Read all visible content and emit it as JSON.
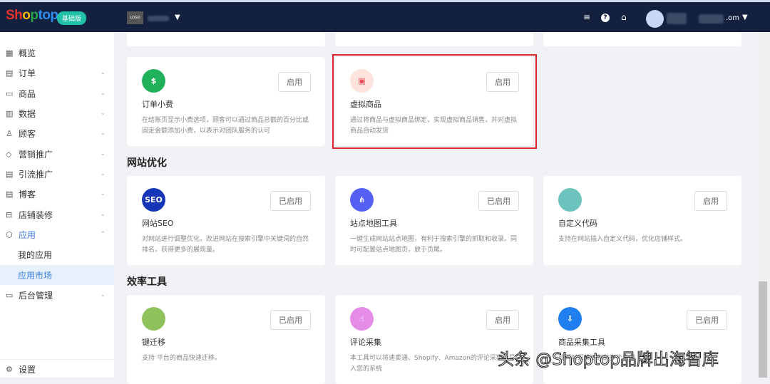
{
  "header": {
    "logo": "Shoptop",
    "plan": "基础版",
    "store_logo": "LOGO",
    "account_suffix": ".om"
  },
  "sidebar": {
    "items": [
      {
        "label": "概览",
        "icon": "dashboard-icon"
      },
      {
        "label": "订单",
        "icon": "order-icon"
      },
      {
        "label": "商品",
        "icon": "product-icon"
      },
      {
        "label": "数据",
        "icon": "chart-icon"
      },
      {
        "label": "顾客",
        "icon": "user-icon"
      },
      {
        "label": "营销推广",
        "icon": "tag-icon"
      },
      {
        "label": "引流推广",
        "icon": "traffic-icon"
      },
      {
        "label": "博客",
        "icon": "blog-icon"
      },
      {
        "label": "店铺装修",
        "icon": "store-icon"
      },
      {
        "label": "应用",
        "icon": "app-icon"
      }
    ],
    "sub": [
      "我的应用",
      "应用市场"
    ],
    "admin": "后台管理",
    "settings": "设置"
  },
  "sections": {
    "seo": "网站优化",
    "efficiency": "效率工具"
  },
  "cards": [
    {
      "title": "订单小费",
      "desc": "在结账页显示小费选项，顾客可以通过商品总额的百分比或固定金额添加小费，以表示对团队服务的认可",
      "button": "启用",
      "color": "#1fb25a"
    },
    {
      "title": "虚拟商品",
      "desc": "通过将商品与虚拟商品绑定，实现虚拟商品销售，并对虚拟商品自动发货",
      "button": "启用",
      "color": "#fde3dc"
    },
    {
      "title": "网站SEO",
      "desc": "对网站进行调整优化，改进网站在搜索引擎中关键词的自然排名，获得更多的展现量。",
      "button": "已启用",
      "color": "#1636b8",
      "icon_text": "SEO"
    },
    {
      "title": "站点地图工具",
      "desc": "一键生成网站站点地图，有利于搜索引擎的抓取和收录。同时可配置站点地图页，放于页尾。",
      "button": "已启用",
      "color": "#5561f5"
    },
    {
      "title": "自定义代码",
      "desc": "支持在网站插入自定义代码，优化店铺样式。",
      "button": "启用",
      "color": "#6cc2bd"
    },
    {
      "title": "键迁移",
      "desc": "支持                  平台的商品快速迁移。",
      "button": "已启用",
      "color": "#8fc25a"
    },
    {
      "title": "评论采集",
      "desc": "本工具可以将速卖通、Shopify、Amazon的评论采集并导入您的系统",
      "button": "启用",
      "color": "#e58be8"
    },
    {
      "title": "商品采集工具",
      "desc": "或同时采集到您的多个店铺",
      "button": "已启用",
      "color": "#1f7ef0"
    }
  ],
  "watermark": "头条 @Shoptop品牌出海智库"
}
